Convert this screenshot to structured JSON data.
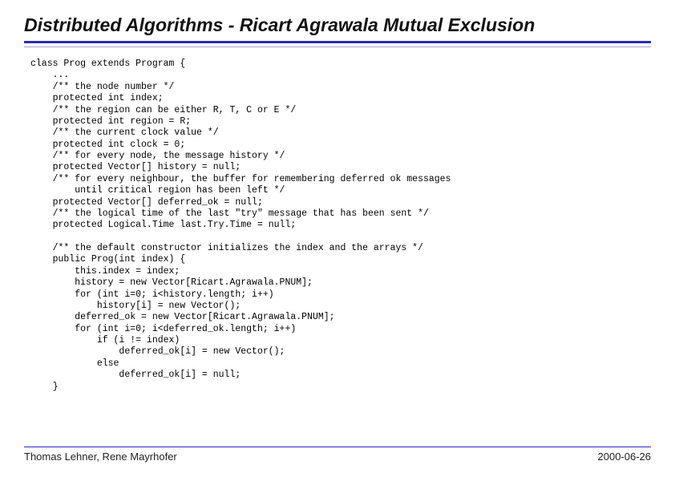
{
  "title": "Distributed Algorithms - Ricart Agrawala Mutual Exclusion",
  "code": "class Prog extends Program {\n    ...\n    /** the node number */\n    protected int index;\n    /** the region can be either R, T, C or E */\n    protected int region = R;\n    /** the current clock value */\n    protected int clock = 0;\n    /** for every node, the message history */\n    protected Vector[] history = null;\n    /** for every neighbour, the buffer for remembering deferred ok messages\n        until critical region has been left */\n    protected Vector[] deferred_ok = null;\n    /** the logical time of the last \"try\" message that has been sent */\n    protected Logical.Time last.Try.Time = null;\n\n    /** the default constructor initializes the index and the arrays */\n    public Prog(int index) {\n        this.index = index;\n        history = new Vector[Ricart.Agrawala.PNUM];\n        for (int i=0; i<history.length; i++)\n            history[i] = new Vector();\n        deferred_ok = new Vector[Ricart.Agrawala.PNUM];\n        for (int i=0; i<deferred_ok.length; i++)\n            if (i != index)\n                deferred_ok[i] = new Vector();\n            else\n                deferred_ok[i] = null;\n    }",
  "footer": {
    "authors": "Thomas Lehner, Rene Mayrhofer",
    "date": "2000-06-26"
  }
}
